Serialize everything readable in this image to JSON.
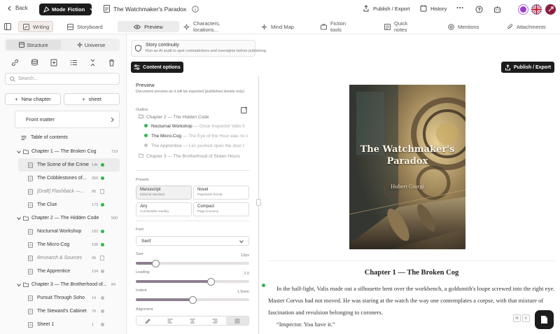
{
  "topbar": {
    "back_label": "Back",
    "mode_label": "Mode",
    "mode_value": "Fiction",
    "doc_title": "The Watchmaker's Paradox",
    "publish_label": "Publish / Export",
    "history_label": "History"
  },
  "tabs": [
    {
      "label": "Writing",
      "icon": "pen-icon"
    },
    {
      "label": "Storyboard",
      "icon": "grid-icon"
    },
    {
      "label": "Preview",
      "icon": "eye-icon"
    },
    {
      "label": "Characters, locations...",
      "icon": "sparkle-icon"
    },
    {
      "label": "Mind Map",
      "icon": "mindmap-icon"
    },
    {
      "label": "Fiction tools",
      "icon": "tools-icon"
    },
    {
      "label": "Quick notes",
      "icon": "note-icon"
    },
    {
      "label": "Mentions",
      "icon": "at-icon"
    },
    {
      "label": "Attachments",
      "icon": "paperclip-icon"
    }
  ],
  "active_tab": "Preview",
  "sidebar": {
    "segments": [
      "Structure",
      "Universe"
    ],
    "active_segment": "Structure",
    "search_placeholder": "Search...",
    "new_chapter_label": "New chapter",
    "sheet_label": "sheet",
    "front_matter_label": "Front matter",
    "toc_label": "Table of contents",
    "chapters": [
      {
        "title": "Chapter 1 — The Broken Cog",
        "count": "719",
        "items": [
          {
            "label": "The Scene of the Crime",
            "count": "14k",
            "status": "green",
            "selected": true
          },
          {
            "label": "The Cobblestones of...",
            "count": "350",
            "status": "green"
          },
          {
            "label": "[Draft] Flashback —...",
            "count": "85",
            "status": "doc",
            "draft": true
          },
          {
            "label": "The Clue",
            "count": "173",
            "status": "green"
          }
        ]
      },
      {
        "title": "Chapter 2 — The Hidden Code",
        "count": "500",
        "items": [
          {
            "label": "Nocturnal Workshop",
            "count": "182",
            "status": "green"
          },
          {
            "label": "The Micro-Cog",
            "count": "108",
            "status": "green"
          },
          {
            "label": "Research & Sources",
            "count": "95",
            "status": "doc",
            "draft": true
          },
          {
            "label": "The Apprentice",
            "count": "134",
            "status": "gray"
          }
        ]
      },
      {
        "title": "Chapter 3 — The Brotherhood of...",
        "count": "84",
        "items": [
          {
            "label": "Pursuit Through Soho",
            "count": "14",
            "status": "gray"
          },
          {
            "label": "The Steward's Cabinet",
            "count": "70",
            "status": "gray"
          },
          {
            "label": "Sheet 1",
            "count": "1",
            "status": "gray"
          }
        ]
      }
    ]
  },
  "middle": {
    "continuity_title": "Story continuity",
    "continuity_desc": "Run an AI audit to spot contradictions and oversights before publishing.",
    "content_options_label": "Content options",
    "preview_title": "Preview",
    "preview_desc": "Document preview as it will be exported (published sheets only)",
    "outline_label": "Outline",
    "outline": [
      {
        "title": "Chapter 2 — The Hidden Code",
        "sub": "",
        "kind": "chapter"
      },
      {
        "title": "Nocturnal Workshop",
        "sub": "— Once Inspector Valis h",
        "kind": "green"
      },
      {
        "title": "The Micro-Cog",
        "sub": "— The Eye of the Hour was no c",
        "kind": "green"
      },
      {
        "title": "The Apprentice",
        "sub": "— Licr pushed open the door t",
        "kind": "gray"
      },
      {
        "title": "Chapter 3 — The Brotherhood of Stolen Hours",
        "sub": "",
        "kind": "chapter"
      }
    ],
    "presets_label": "Presets",
    "presets": [
      {
        "name": "Manuscript",
        "desc": "Editorial standard",
        "selected": true
      },
      {
        "name": "Novel",
        "desc": "Paperback format"
      },
      {
        "name": "Airy",
        "desc": "Comfortable reading"
      },
      {
        "name": "Compact",
        "desc": "Page economy"
      }
    ],
    "font_label": "Font",
    "font_value": "Serif",
    "size_label": "Size",
    "size_value": "12px",
    "size_fraction": 0.17,
    "leading_label": "Leading",
    "leading_value": "2.0",
    "leading_fraction": 0.66,
    "indent_label": "Indent",
    "indent_value": "1.5rem",
    "indent_fraction": 0.5,
    "alignment_label": "Alignment"
  },
  "preview": {
    "publish_label": "Publish / Export",
    "cover_title": "The Watchmaker's Paradox",
    "cover_author": "Hubert Giorgi",
    "chapter_heading": "Chapter 1 — The Broken Cog",
    "paragraphs": [
      "In the half-light, Valis made out a silhouette bent over the workbench, a goldsmith's loupe screwed into the right eye. Master Corvus had not moved. He was staring at the watch the way one contemplates a corpse, with that mixture of fascination and revulsion belonging to coroners.",
      "“Inspector. You have it.”"
    ],
    "kbd_hints": [
      "⌘",
      "K"
    ]
  },
  "colors": {
    "accent_dark": "#1c1c1c",
    "status_green": "#2fb64f",
    "slider_fill": "#8f7e91"
  }
}
